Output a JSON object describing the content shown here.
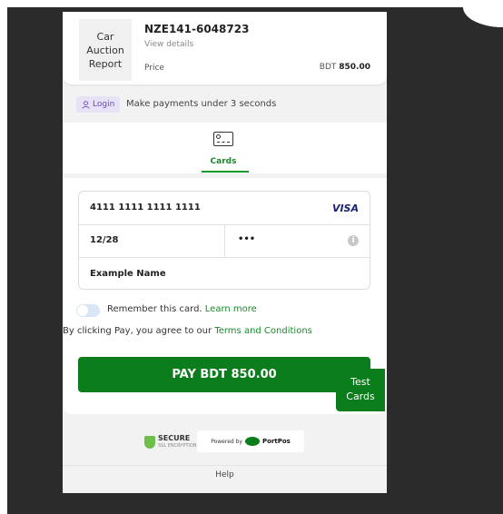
{
  "product": {
    "report_line1": "Car",
    "report_line2": "Auction",
    "report_line3": "Report",
    "order_id": "NZE141-6048723",
    "view_details": "View details",
    "price_label": "Price",
    "price_currency": "BDT",
    "price_amount": "850.00"
  },
  "login": {
    "button_label": "Login",
    "tagline": "Make payments under 3 seconds"
  },
  "tabs": [
    {
      "label": "Cards",
      "active": true
    }
  ],
  "card_form": {
    "card_number": "4111 1111 1111 1111",
    "brand": "VISA",
    "expiry": "12/28",
    "cvv": "•••",
    "name": "Example Name"
  },
  "remember": {
    "text": "Remember this card.",
    "link": "Learn more"
  },
  "terms": {
    "text": "By clicking Pay, you agree to our",
    "link": "Terms and Conditions"
  },
  "pay_button": "PAY BDT 850.00",
  "test_cards": {
    "line1": "Test",
    "line2": "Cards"
  },
  "footer": {
    "secure": "SECURE",
    "secure_sub": "SSL ENCRYPTION",
    "powered_by": "Powered by",
    "brand": "PortPos",
    "help": "Help"
  },
  "colors": {
    "accent_green": "#0c7d1c",
    "login_purple": "#6b46c1",
    "visa_blue": "#1a1f71"
  },
  "icons": {
    "login": "user-icon",
    "tab": "credit-card-icon",
    "info": "info-icon",
    "secure": "shield-check-icon",
    "portpos": "portpos-logo-icon"
  }
}
